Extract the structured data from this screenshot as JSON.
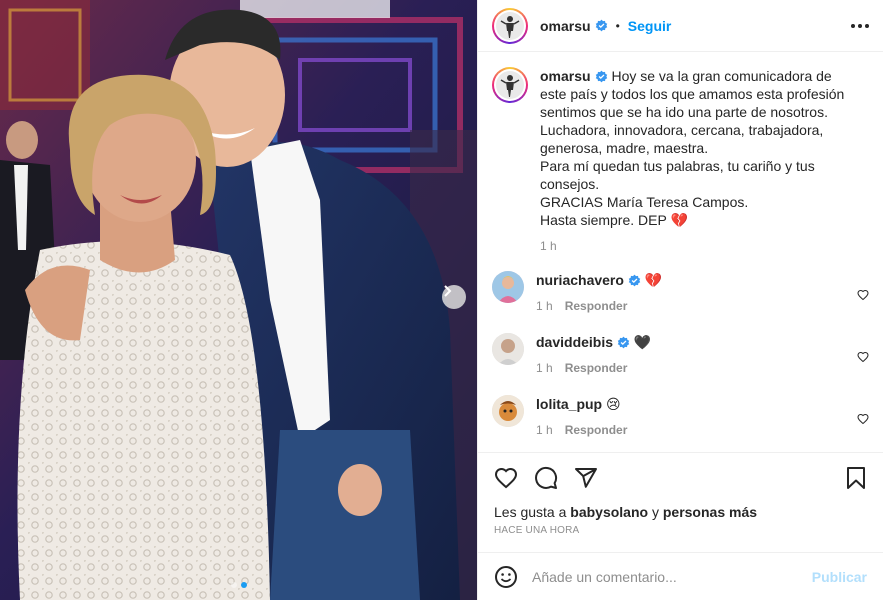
{
  "post": {
    "username": "omarsu",
    "follow_label": "Seguir",
    "separator": "•"
  },
  "caption": {
    "username": "omarsu",
    "text": "Hoy se va la gran comunicadora de este país y todos los que amamos esta profesión sentimos que se ha ido una parte de nosotros. Luchadora, innovadora, cercana, trabajadora, generosa, madre, maestra.\nPara mí quedan tus palabras, tu cariño y tus consejos.\nGRACIAS María Teresa Campos.\nHasta siempre. DEP 💔",
    "time": "1 h"
  },
  "comments": [
    {
      "username": "nuriachavero",
      "verified": true,
      "text": "💔",
      "time": "1 h",
      "reply_label": "Responder"
    },
    {
      "username": "daviddeibis",
      "verified": true,
      "text": "🖤",
      "time": "1 h",
      "reply_label": "Responder"
    },
    {
      "username": "lolita_pup",
      "verified": false,
      "text": "😢",
      "time": "1 h",
      "reply_label": "Responder"
    }
  ],
  "likes": {
    "prefix": "Les gusta a",
    "user": "babysolano",
    "connector": "y",
    "others": "personas más"
  },
  "time_ago": "HACE UNA HORA",
  "add_comment": {
    "placeholder": "Añade un comentario...",
    "publish_label": "Publicar"
  },
  "colors": {
    "link_blue": "#0095f6",
    "verified_blue": "#3897f0",
    "publish_disabled": "#b2dffc",
    "carousel_active": "#1a9cf2"
  },
  "icons": {
    "carousel_next": "chevron-right-icon",
    "like": "heart-icon",
    "comment": "comment-bubble-icon",
    "share": "paper-plane-icon",
    "save": "bookmark-icon",
    "emoji": "smiley-icon",
    "more": "more-dots-icon"
  }
}
